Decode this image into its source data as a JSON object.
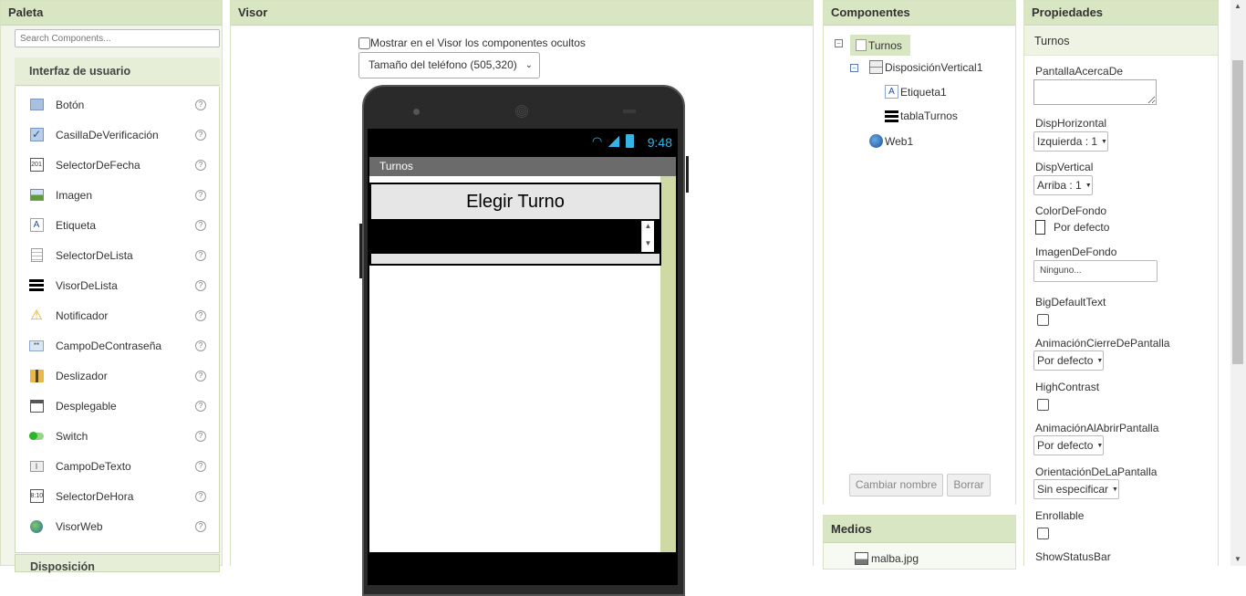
{
  "paleta": {
    "title": "Paleta",
    "search_placeholder": "Search Components...",
    "category": "Interfaz de usuario",
    "next_category": "Disposición",
    "help": "?",
    "items": [
      {
        "label": "Botón",
        "icon": "button-icon"
      },
      {
        "label": "CasillaDeVerificación",
        "icon": "checkbox-icon"
      },
      {
        "label": "SelectorDeFecha",
        "icon": "datepicker-icon"
      },
      {
        "label": "Imagen",
        "icon": "image-icon"
      },
      {
        "label": "Etiqueta",
        "icon": "label-icon"
      },
      {
        "label": "SelectorDeLista",
        "icon": "listpicker-icon"
      },
      {
        "label": "VisorDeLista",
        "icon": "listview-icon"
      },
      {
        "label": "Notificador",
        "icon": "notifier-icon"
      },
      {
        "label": "CampoDeContraseña",
        "icon": "password-icon"
      },
      {
        "label": "Deslizador",
        "icon": "slider-icon"
      },
      {
        "label": "Desplegable",
        "icon": "spinner-icon"
      },
      {
        "label": "Switch",
        "icon": "switch-icon"
      },
      {
        "label": "CampoDeTexto",
        "icon": "textbox-icon"
      },
      {
        "label": "SelectorDeHora",
        "icon": "timepicker-icon"
      },
      {
        "label": "VisorWeb",
        "icon": "webviewer-icon"
      }
    ]
  },
  "visor": {
    "title": "Visor",
    "hidden_label": "Mostrar en el Visor los componentes ocultos",
    "size_select": "Tamaño del teléfono (505,320)",
    "phone": {
      "clock": "9:48",
      "screen_title": "Turnos",
      "label_text": "Elegir Turno"
    }
  },
  "componentes": {
    "title": "Componentes",
    "tree": {
      "root": "Turnos",
      "vertical": "DisposiciónVertical1",
      "label": "Etiqueta1",
      "table": "tablaTurnos",
      "web": "Web1"
    },
    "rename_button": "Cambiar nombre",
    "delete_button": "Borrar"
  },
  "medios": {
    "title": "Medios",
    "file": "malba.jpg"
  },
  "propiedades": {
    "title": "Propiedades",
    "component": "Turnos",
    "about_label": "PantallaAcercaDe",
    "align_h_label": "DispHorizontal",
    "align_h_value": "Izquierda : 1",
    "align_v_label": "DispVertical",
    "align_v_value": "Arriba : 1",
    "bg_color_label": "ColorDeFondo",
    "bg_color_value": "Por defecto",
    "bg_image_label": "ImagenDeFondo",
    "bg_image_value": "Ninguno...",
    "big_text_label": "BigDefaultText",
    "close_anim_label": "AnimaciónCierreDePantalla",
    "close_anim_value": "Por defecto",
    "high_contrast_label": "HighContrast",
    "open_anim_label": "AnimaciónAlAbrirPantalla",
    "open_anim_value": "Por defecto",
    "orientation_label": "OrientaciónDeLaPantalla",
    "orientation_value": "Sin especificar",
    "scrollable_label": "Enrollable",
    "status_bar_label": "ShowStatusBar"
  },
  "colors": {
    "header_green": "#d9e6c3",
    "accent_blue": "#35b5e5",
    "screen_side": "#cfd9a4"
  }
}
